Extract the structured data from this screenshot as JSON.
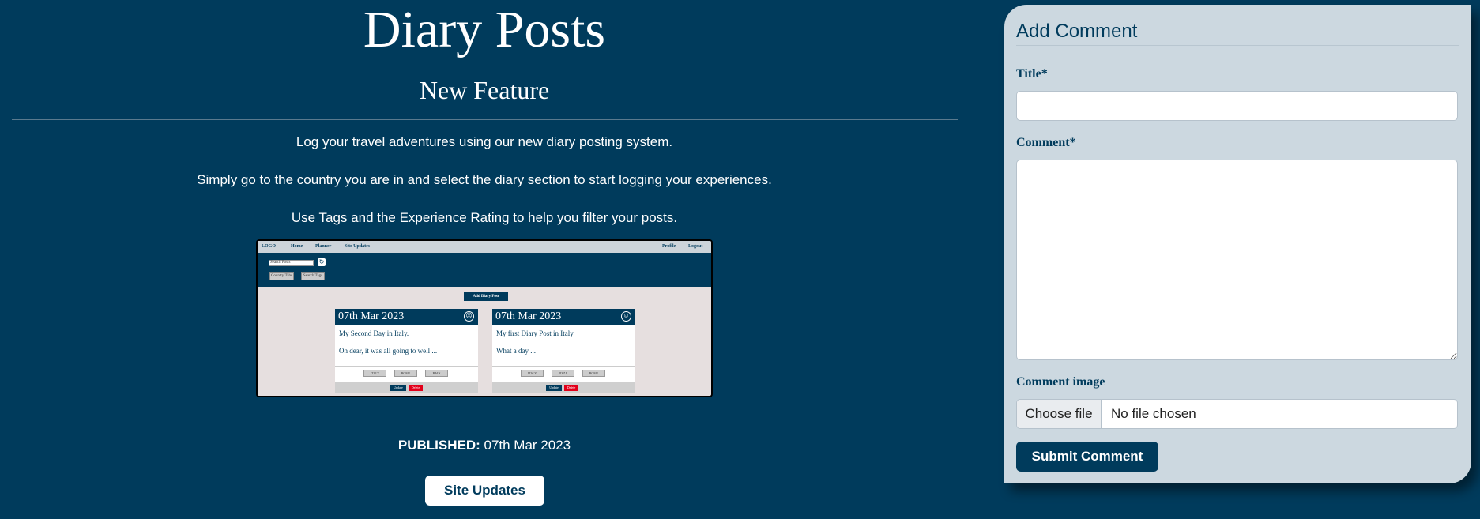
{
  "main": {
    "page_title": "Diary Posts",
    "post_title": "New Feature",
    "paragraphs": [
      "Log your travel adventures using our new diary posting system.",
      "Simply go to the country you are in and select the diary section to start logging your experiences.",
      "Use Tags and the Experience Rating to help you filter your posts."
    ],
    "published_label": "PUBLISHED:",
    "published_date": "07th Mar 2023",
    "site_updates_button": "Site Updates"
  },
  "preview": {
    "nav": {
      "logo": "LOGO",
      "home": "Home",
      "planner": "Planner",
      "site_updates": "Site Updates",
      "profile": "Profile",
      "logout": "Logout"
    },
    "search_placeholder": "Search Posts",
    "country_tabs": "Country Tabs",
    "search_tags": "Search Tags",
    "add_diary_post": "Add Diary Post",
    "cards": [
      {
        "date": "07th Mar 2023",
        "title": "My Second Day in Italy.",
        "excerpt": "Oh dear, it was all going to well ...",
        "tags": [
          "ITALY",
          "ROME",
          "RAIN"
        ],
        "mood": "sad",
        "update": "Update",
        "delete": "Delete"
      },
      {
        "date": "07th Mar 2023",
        "title": "My first Diary Post in Italy",
        "excerpt": "What a day ...",
        "tags": [
          "ITALY",
          "PIZZA",
          "ROME"
        ],
        "mood": "happy",
        "update": "Update",
        "delete": "Delete"
      }
    ]
  },
  "comment_form": {
    "heading": "Add Comment",
    "title_label": "Title*",
    "comment_label": "Comment*",
    "image_label": "Comment image",
    "choose_file": "Choose file",
    "no_file": "No file chosen",
    "submit": "Submit Comment"
  },
  "colors": {
    "primary": "#003b5c",
    "panel": "#ccd8e0",
    "delete": "#e2001a"
  }
}
